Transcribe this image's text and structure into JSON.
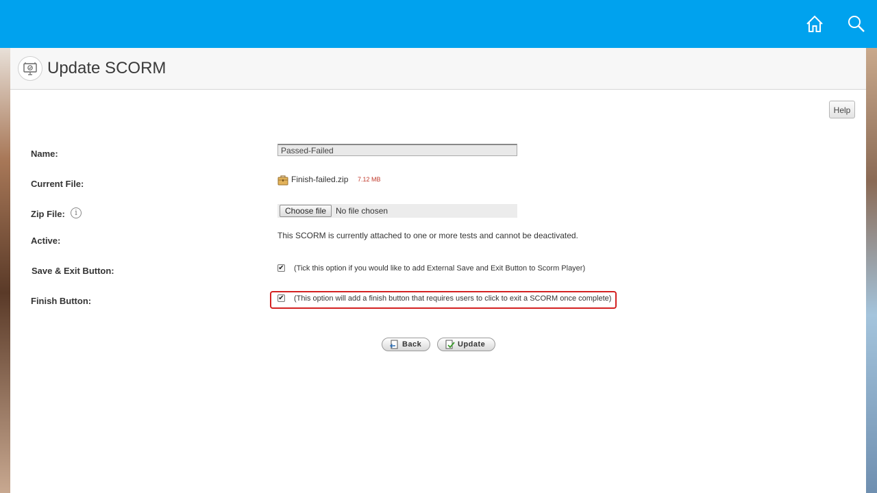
{
  "header": {
    "title": "Update SCORM",
    "help_label": "Help"
  },
  "topbar": {
    "color": "#00a2ee",
    "icons": [
      "home-icon",
      "search-icon"
    ]
  },
  "form": {
    "name": {
      "label": "Name:",
      "value": "Passed-Failed"
    },
    "current_file": {
      "label": "Current File:",
      "file_name": "Finish-failed.zip",
      "file_size": "7.12 MB"
    },
    "zip_file": {
      "label": "Zip File:",
      "button_label": "Choose file",
      "status": "No file chosen"
    },
    "active": {
      "label": "Active:",
      "text": "This SCORM is currently attached to one or more tests and cannot be deactivated."
    },
    "save_exit": {
      "label": "Save & Exit Button:",
      "checked": true,
      "description": "(Tick this option if you would like to add External Save and Exit Button to Scorm Player)"
    },
    "finish": {
      "label": "Finish Button:",
      "checked": true,
      "description": "(This option will add a finish button that requires users to click to exit a SCORM once complete)"
    }
  },
  "actions": {
    "back_label": "Back",
    "update_label": "Update"
  },
  "colors": {
    "highlight_border": "#d32020",
    "file_size": "#c0392b"
  }
}
